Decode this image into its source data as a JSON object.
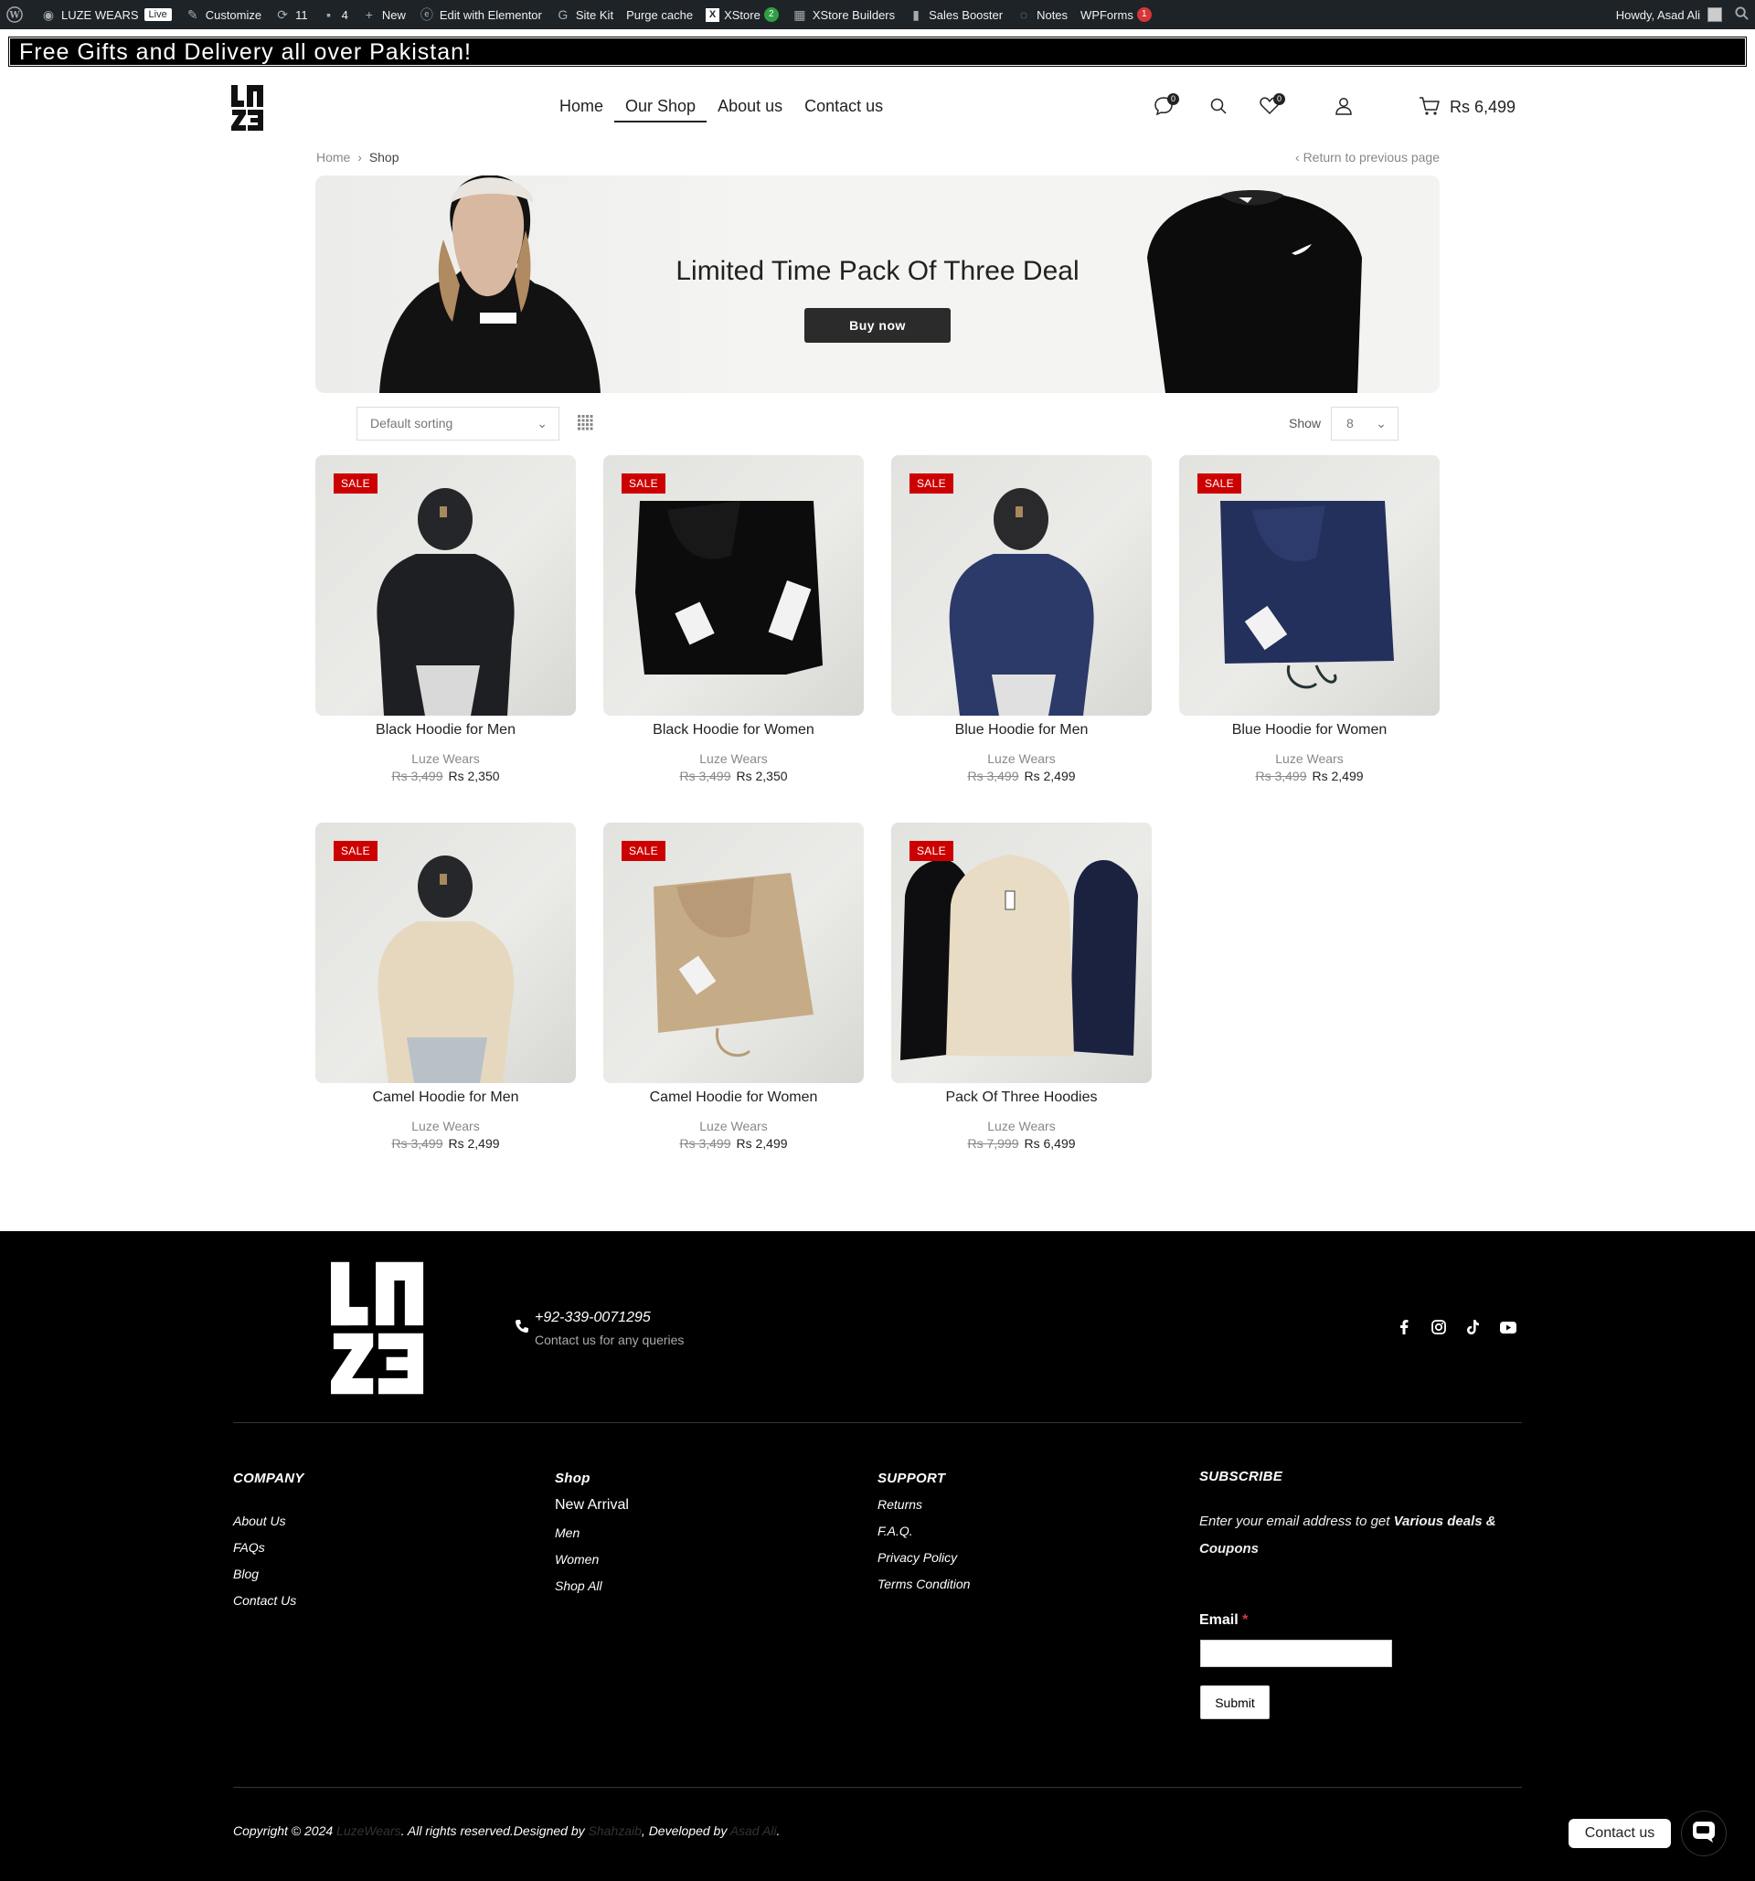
{
  "adminbar": {
    "site_name": "LUZE WEARS",
    "live_label": "Live",
    "customize": "Customize",
    "updates_count": "11",
    "comments_count": "4",
    "new_label": "New",
    "elementor": "Edit with Elementor",
    "site_kit": "Site Kit",
    "purge_cache": "Purge cache",
    "xstore": "XStore",
    "xstore_badge": "2",
    "xstore_builders": "XStore Builders",
    "sales_booster": "Sales Booster",
    "notes": "Notes",
    "wpforms": "WPForms",
    "wpforms_badge": "1",
    "howdy": "Howdy, Asad Ali"
  },
  "promo": {
    "text": "Free Gifts and Delivery all over Pakistan!"
  },
  "nav": {
    "items": [
      "Home",
      "Our Shop",
      "About us",
      "Contact us"
    ],
    "active_index": 1
  },
  "header": {
    "compare_count": "0",
    "wishlist_count": "0",
    "cart_total": "Rs 6,499"
  },
  "breadcrumb": {
    "home": "Home",
    "current": "Shop",
    "back": "Return to previous page"
  },
  "banner": {
    "title": "Limited Time Pack Of Three Deal",
    "button": "Buy  now"
  },
  "toolbar": {
    "sort": "Default sorting",
    "show_label": "Show",
    "show_value": "8"
  },
  "products": [
    {
      "sale": "SALE",
      "name": "Black Hoodie for Men",
      "brand": "Luze Wears",
      "old_price": "Rs 3,499",
      "price": "Rs 2,350"
    },
    {
      "sale": "SALE",
      "name": "Black Hoodie for Women",
      "brand": "Luze Wears",
      "old_price": "Rs 3,499",
      "price": "Rs 2,350"
    },
    {
      "sale": "SALE",
      "name": "Blue Hoodie for Men",
      "brand": "Luze Wears",
      "old_price": "Rs 3,499",
      "price": "Rs 2,499"
    },
    {
      "sale": "SALE",
      "name": "Blue Hoodie for Women",
      "brand": "Luze Wears",
      "old_price": "Rs 3,499",
      "price": "Rs 2,499"
    },
    {
      "sale": "SALE",
      "name": "Camel Hoodie for Men",
      "brand": "Luze Wears",
      "old_price": "Rs 3,499",
      "price": "Rs 2,499"
    },
    {
      "sale": "SALE",
      "name": "Camel Hoodie for Women",
      "brand": "Luze Wears",
      "old_price": "Rs 3,499",
      "price": "Rs 2,499"
    },
    {
      "sale": "SALE",
      "name": "Pack Of Three Hoodies",
      "brand": "Luze Wears",
      "old_price": "Rs 7,999",
      "price": "Rs 6,499"
    }
  ],
  "footer": {
    "phone": "+92-339-0071295",
    "phone_sub": "Contact us for any queries",
    "company": {
      "title": "COMPANY",
      "links": [
        "About Us",
        "FAQs",
        "Blog",
        "Contact Us"
      ]
    },
    "shop": {
      "title": "Shop",
      "links": [
        "New Arrival",
        "Men",
        "Women",
        "Shop All"
      ]
    },
    "support": {
      "title": "SUPPORT",
      "links": [
        "Returns",
        "F.A.Q.",
        "Privacy Policy",
        "Terms Condition"
      ]
    },
    "subscribe": {
      "title": "SUBSCRIBE",
      "text_a": "Enter your email address to get ",
      "text_b": "Various deals & Coupons",
      "email_label": "Email",
      "required": "*",
      "submit": "Submit"
    },
    "copyright_a": "Copyright © 2024 ",
    "copyright_brand": "LuzeWears",
    "copyright_b": ". All rights reserved.Designed by ",
    "designer": "Shahzaib",
    "copyright_c": ", Developed by ",
    "developer": "Asad Ali",
    "copyright_d": "."
  },
  "contact_widget": {
    "label": "Contact us"
  }
}
